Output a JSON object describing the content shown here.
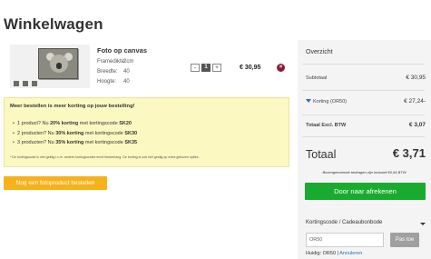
{
  "page": {
    "title": "Winkelwagen"
  },
  "product": {
    "title": "Foto op canvas",
    "specs": [
      {
        "label": "Framedikte:",
        "value": "2cm"
      },
      {
        "label": "Breedte:",
        "value": "40"
      },
      {
        "label": "Hoogte:",
        "value": "40"
      }
    ],
    "qty_minus": "-",
    "quantity": "1",
    "qty_plus": "+",
    "price": "€ 30,95",
    "remove_icon": "×"
  },
  "promo": {
    "title": "Meer bestellen is meer korting op jouw bestelling!",
    "lines": [
      {
        "prefix": "1 product? Nu ",
        "discount": "20% korting",
        "mid": " met kortingscode ",
        "code": "SK20"
      },
      {
        "prefix": "2 producten? Nu ",
        "discount": "30% korting",
        "mid": " met kortingscode ",
        "code": "SK30"
      },
      {
        "prefix": "3 producten? Nu ",
        "discount": "35% korting",
        "mid": " met kortingscode ",
        "code": "SK35"
      }
    ],
    "note": "* De kortingscode is niet geldig i.c.m. andere kortingscodes en/of fotobehang. De korting is ook niet geldig op extra gekozen opties."
  },
  "order_more_button": "Nog een fotoproduct bestellen",
  "overview": {
    "title": "Overzicht",
    "subtotal_label": "Subtotaal",
    "subtotal_value": "€ 30,95",
    "discount_label": "Korting (OR50)",
    "discount_value": "€ 27,24-",
    "excl_label": "Totaal Excl. BTW",
    "excl_value": "€ 3,07",
    "total_label": "Totaal",
    "total_value": "€ 3,71",
    "vat_note": "Bovengenoemde bedragen zijn inclusief €0,64 BTW",
    "checkout_button": "Door naar afrekenen"
  },
  "coupon": {
    "title": "Kortingscode / Cadeaubonbode",
    "input_value": "OR50",
    "apply_button": "Pas toe",
    "current_prefix": "Huidig: OR50 | ",
    "cancel_link": "Annuleren"
  },
  "colors": {
    "checkout_green": "#19ab30",
    "order_more_orange": "#f6b21a",
    "promo_yellow": "#fcf8c2",
    "remove_red": "#8c1c3a",
    "link_blue": "#2a6fbf"
  }
}
